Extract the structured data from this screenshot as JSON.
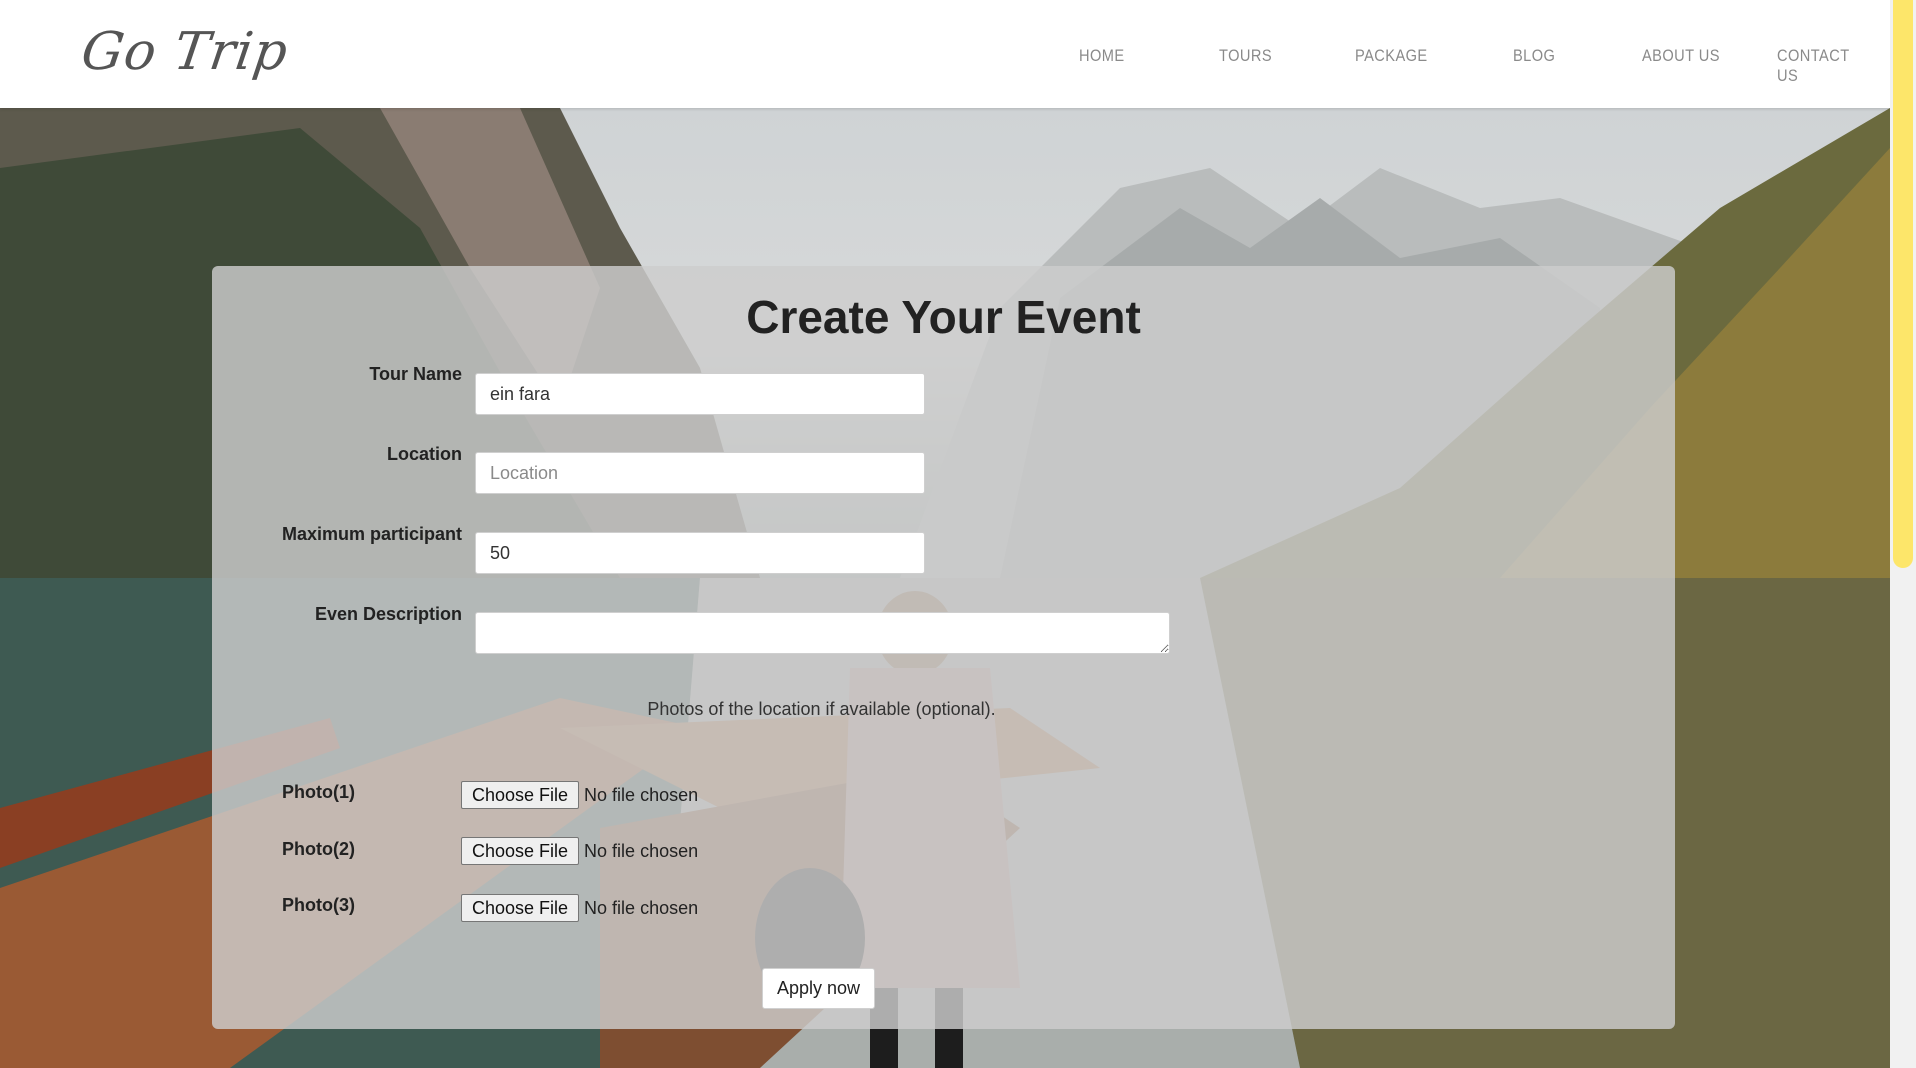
{
  "header": {
    "logo": "Go Trip",
    "nav": [
      {
        "label": "HOME"
      },
      {
        "label": "TOURS"
      },
      {
        "label": "PACKAGE"
      },
      {
        "label": "BLOG"
      },
      {
        "label": "ABOUT US"
      },
      {
        "label": "CONTACT US"
      }
    ]
  },
  "form": {
    "title": "Create Your Event",
    "fields": {
      "tour_name": {
        "label": "Tour Name",
        "value": "ein fara",
        "placeholder": "Tour Name"
      },
      "location": {
        "label": "Location",
        "value": "",
        "placeholder": "Location"
      },
      "max_participant": {
        "label": "Maximum participant",
        "value": "50"
      },
      "description": {
        "label": "Even Description",
        "value": ""
      }
    },
    "photos_note": "Photos of the location if available (optional).",
    "photos": [
      {
        "label": "Photo(1)",
        "button": "Choose File",
        "status": "No file chosen"
      },
      {
        "label": "Photo(2)",
        "button": "Choose File",
        "status": "No file chosen"
      },
      {
        "label": "Photo(3)",
        "button": "Choose File",
        "status": "No file chosen"
      }
    ],
    "submit_label": "Apply now"
  },
  "theme": {
    "scrollbar_thumb": "#fde66a",
    "nav_text": "#8a8a8a",
    "card_overlay": "#cdcdcd"
  }
}
